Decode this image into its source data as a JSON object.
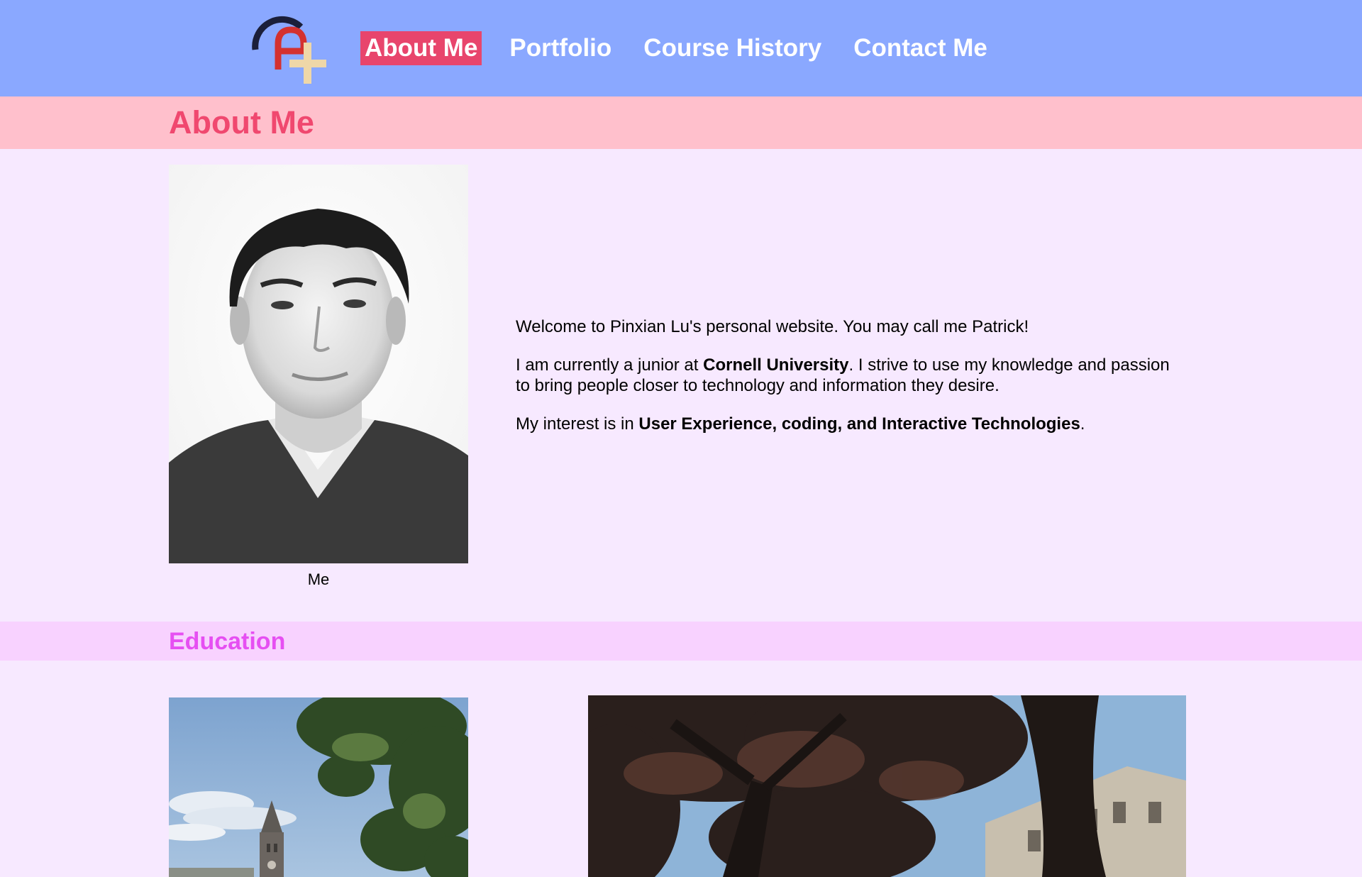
{
  "nav": {
    "logo": "CP+ logo",
    "links": [
      {
        "label": "About Me",
        "active": true
      },
      {
        "label": "Portfolio",
        "active": false
      },
      {
        "label": "Course History",
        "active": false
      },
      {
        "label": "Contact Me",
        "active": false
      }
    ]
  },
  "about": {
    "heading": "About Me",
    "photo_caption": "Me",
    "welcome": "Welcome to Pinxian Lu's personal website. You may call me Patrick!",
    "p2_before": "I am currently a junior at ",
    "p2_bold": "Cornell University",
    "p2_after": ". I strive to use my knowledge and passion to bring people closer to technology and information they desire.",
    "p3_before": "My interest is in ",
    "p3_bold": "User Experience, coding, and Interactive Technologies",
    "p3_after": "."
  },
  "education": {
    "heading": "Education"
  },
  "colors": {
    "nav_bg": "#8aa8ff",
    "active_link_bg": "#e8456c",
    "about_band_bg": "#ffc0cc",
    "about_heading": "#f0486f",
    "education_band_bg": "#f8d2ff",
    "education_heading": "#e64ff2",
    "page_bg": "#f7e9ff"
  }
}
